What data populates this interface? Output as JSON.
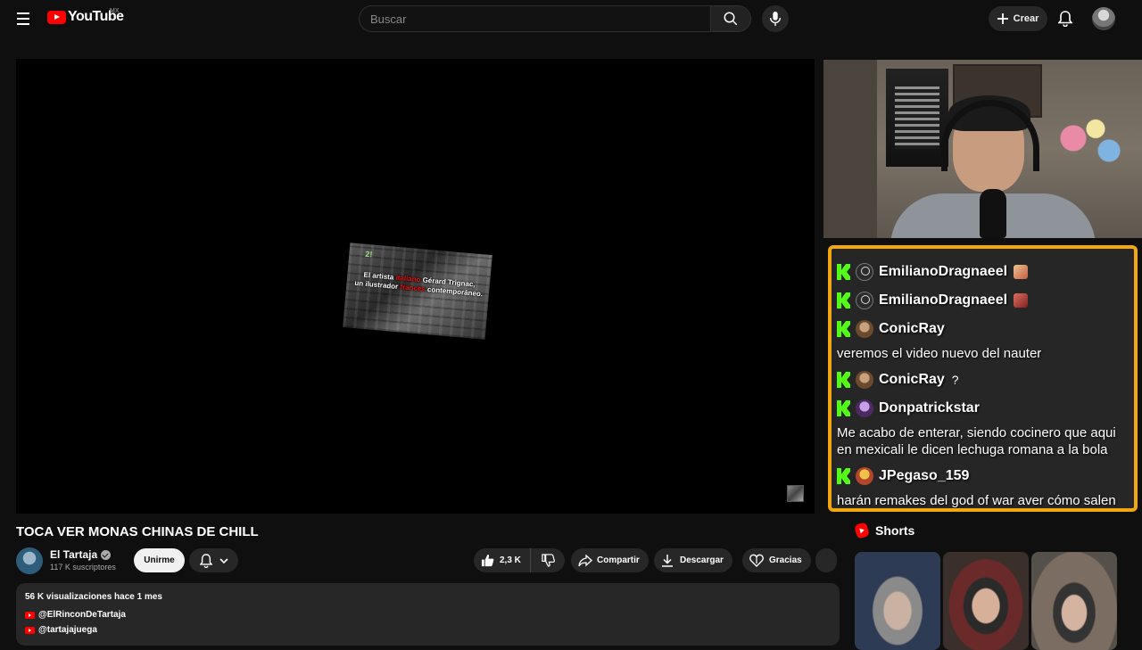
{
  "header": {
    "logo_text": "YouTube",
    "region": "MX",
    "search_placeholder": "Buscar",
    "create_label": "Crear"
  },
  "player": {
    "overlay_badge": "2!",
    "overlay_line1_a": "El artista",
    "overlay_line1_red": "italiano",
    "overlay_line1_b": "Gérard Trignac,",
    "overlay_line2_a": "un ilustrador",
    "overlay_line2_red": "francés",
    "overlay_line2_b": "contemporáneo."
  },
  "chat": {
    "messages": [
      {
        "user": "EmilianoDragnaeel",
        "avatar": "default-avatar",
        "text": ""
      },
      {
        "user": "EmilianoDragnaeel",
        "avatar": "default-avatar",
        "text": ""
      },
      {
        "user": "ConicRay",
        "avatar": "conic-avatar",
        "text": "veremos el video nuevo del nauter"
      },
      {
        "user": "ConicRay",
        "avatar": "conic-avatar",
        "text": "",
        "suffix": "?"
      },
      {
        "user": "Donpatrickstar",
        "avatar": "don-avatar",
        "text": "Me acabo de enterar, siendo cocinero que aqui en mexicali le dicen lechuga romana a la bola"
      },
      {
        "user": "JPegaso_159",
        "avatar": "jpegaso-avatar",
        "text": "harán remakes del god of war aver cómo salen"
      }
    ],
    "border_color": "#f3a70e",
    "brand_color": "#53fc18"
  },
  "video": {
    "title": "TOCA VER MONAS CHINAS DE CHILL",
    "channel_name": "El Tartaja",
    "subscribers": "117 K suscriptores",
    "join_label": "Unirme",
    "like_count": "2,3 K",
    "share_label": "Compartir",
    "download_label": "Descargar",
    "thanks_label": "Gracias"
  },
  "description": {
    "stats": "56 K visualizaciones  hace 1 mes",
    "links": [
      "@ElRinconDeTartaja",
      "@tartajajuega"
    ]
  },
  "shorts": {
    "header": "Shorts"
  }
}
